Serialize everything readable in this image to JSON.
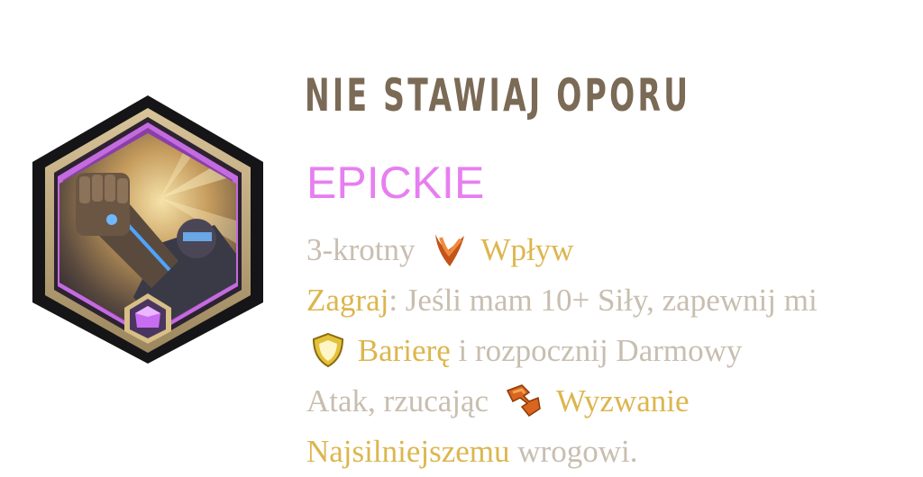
{
  "card": {
    "title": "NIE STAWIAJ OPORU",
    "rarity": "EPICKIE",
    "rarity_color": "#e77ff0",
    "title_color": "#7a6a56",
    "keyword_color": "#dcb64e",
    "text_color": "#c8beb0"
  },
  "description": {
    "line1": {
      "count_text": "3-krotny",
      "keyword": "Wpływ",
      "keyword_icon": "impact-icon"
    },
    "line2": {
      "keyword": "Zagraj",
      "rest": ": Jeśli mam 10+ Siły, zapewnij mi"
    },
    "line3": {
      "keyword": "Barierę",
      "keyword_icon": "barrier-shield-icon",
      "rest": " i rozpocznij Darmowy"
    },
    "line4": {
      "text": "Atak, rzucając",
      "keyword": "Wyzwanie",
      "keyword_icon": "challenger-icon"
    },
    "line5": {
      "keyword": "Najsilniejszemu",
      "rest": " wrogowi."
    }
  },
  "badge": {
    "gem_icon": "epic-gem-icon",
    "art_icon": "card-art-golem-fist"
  }
}
